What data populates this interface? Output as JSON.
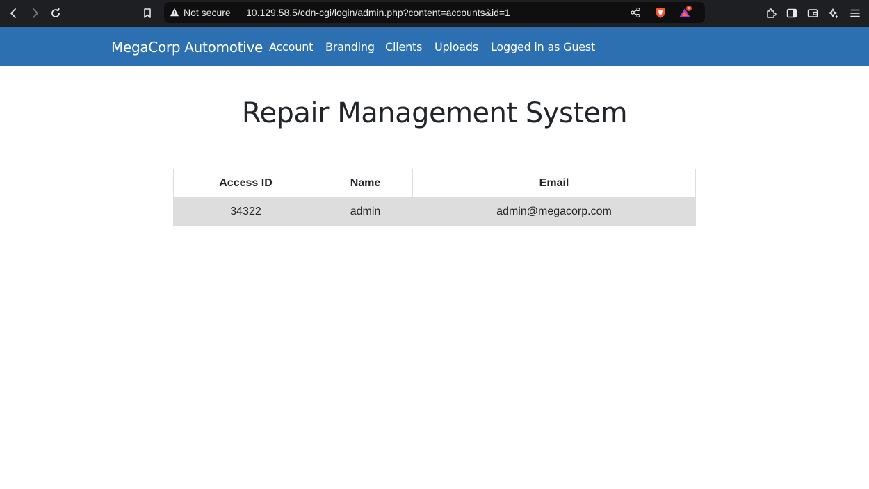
{
  "browser": {
    "security_label": "Not secure",
    "url": "10.129.58.5/cdn-cgi/login/admin.php?content=accounts&id=1",
    "icons": [
      "back-icon",
      "forward-icon",
      "reload-icon",
      "bookmark-icon",
      "warning-icon",
      "share-icon",
      "brave-shield-icon",
      "brave-rewards-icon",
      "extensions-icon",
      "sidebar-icon",
      "wallet-icon",
      "leo-ai-icon",
      "menu-icon"
    ],
    "colors": {
      "chrome_bg": "#1e1f22",
      "url_bg": "#0f0f10"
    }
  },
  "navbar": {
    "brand": "MegaCorp Automotive",
    "links": [
      "Account",
      "Branding",
      "Clients",
      "Uploads",
      "Logged in as Guest"
    ],
    "color": "#2c70b2"
  },
  "main": {
    "title": "Repair Management System",
    "table": {
      "headers": [
        "Access ID",
        "Name",
        "Email"
      ],
      "rows": [
        [
          "34322",
          "admin",
          "admin@megacorp.com"
        ]
      ],
      "row_color": "#dddddd"
    }
  }
}
